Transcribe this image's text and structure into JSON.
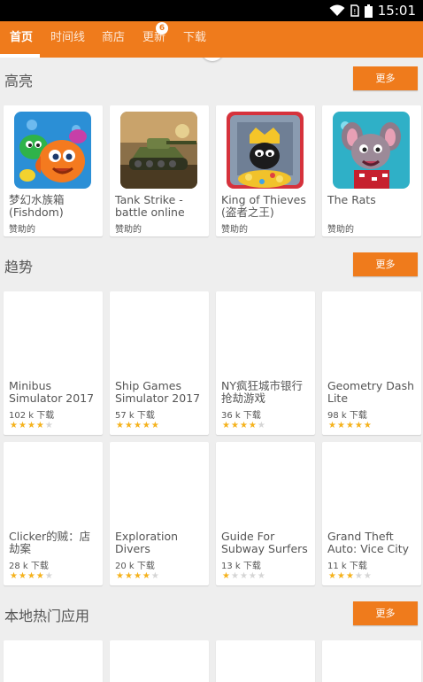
{
  "status_bar": {
    "time": "15:01"
  },
  "tabs": [
    {
      "label": "首页"
    },
    {
      "label": "时间线"
    },
    {
      "label": "商店"
    },
    {
      "label": "更新",
      "badge": "6"
    },
    {
      "label": "下载"
    }
  ],
  "sections": {
    "featured": {
      "title": "高亮",
      "more_label": "更多",
      "items": [
        {
          "title": "梦幻水族箱\n(Fishdom)",
          "subtitle": "赞助的",
          "icon": "fishdom-icon"
        },
        {
          "title": "Tank Strike -\nbattle online",
          "subtitle": "赞助的",
          "icon": "tank-strike-icon"
        },
        {
          "title": "King of Thieves\n(盗者之王)",
          "subtitle": "赞助的",
          "icon": "king-of-thieves-icon"
        },
        {
          "title": "The Rats",
          "subtitle": "赞助的",
          "icon": "the-rats-icon"
        }
      ]
    },
    "trending": {
      "title": "趋势",
      "more_label": "更多",
      "items": [
        {
          "title": "Minibus\nSimulator 2017",
          "downloads": "102 k 下载",
          "rating": 3.5
        },
        {
          "title": "Ship Games\nSimulator 2017",
          "downloads": "57 k 下载",
          "rating": 4.5
        },
        {
          "title": "NY疯狂城市银行\n抢劫游戏",
          "downloads": "36 k 下载",
          "rating": 3.5
        },
        {
          "title": "Geometry Dash\nLite",
          "downloads": "98 k 下载",
          "rating": 4.5
        },
        {
          "title": "Clicker的贼：店\n劫案",
          "downloads": "28 k 下载",
          "rating": 4
        },
        {
          "title": "Exploration\nDivers",
          "downloads": "20 k 下载",
          "rating": 4
        },
        {
          "title": "Guide For\nSubway Surfers",
          "downloads": "13 k 下载",
          "rating": 1
        },
        {
          "title": "Grand Theft\nAuto: Vice City",
          "downloads": "11 k 下载",
          "rating": 3
        }
      ]
    },
    "local_popular": {
      "title": "本地热门应用",
      "more_label": "更多"
    }
  },
  "colors": {
    "accent": "#ef7b1c",
    "star": "#f5b21c"
  }
}
